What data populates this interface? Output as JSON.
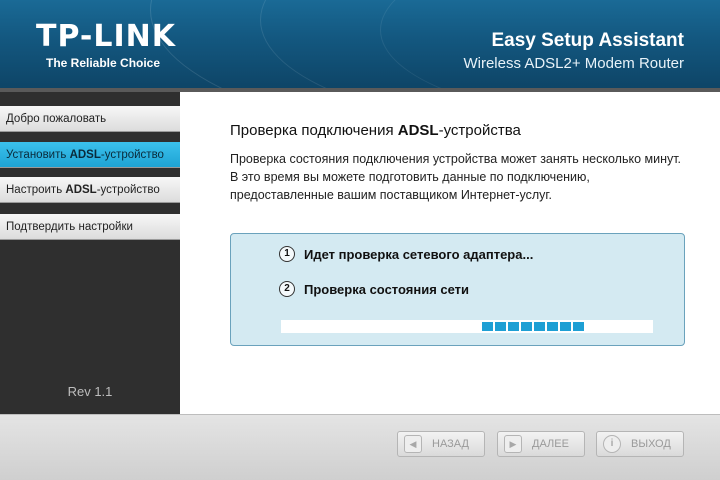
{
  "header": {
    "brand": "TP-LINK",
    "tagline": "The Reliable Choice",
    "title": "Easy Setup Assistant",
    "subtitle": "Wireless ADSL2+ Modem Router"
  },
  "sidebar": {
    "items": [
      {
        "pre": "Добро пожаловать",
        "bold": "",
        "post": ""
      },
      {
        "pre": "Установить ",
        "bold": "ADSL",
        "post": "-устройство"
      },
      {
        "pre": "Настроить ",
        "bold": "ADSL",
        "post": "-устройство"
      },
      {
        "pre": "Подтвердить настройки",
        "bold": "",
        "post": ""
      }
    ],
    "active_index": 1,
    "revision": "Rev 1.1"
  },
  "main": {
    "title_pre": "Проверка подключения ",
    "title_bold": "ADSL",
    "title_post": "-устройства",
    "description": "Проверка состояния подключения устройства может занять несколько минут. В это время вы можете подготовить данные по подключению, предоставленные вашим поставщиком Интернет-услуг.",
    "steps": [
      {
        "num": "1",
        "text": "Идет проверка сетевого адаптера..."
      },
      {
        "num": "2",
        "text": "Проверка состояния сети"
      }
    ],
    "progress": {
      "segment_count": 8,
      "start_fraction": 0.54,
      "accent": "#1e9fd4"
    }
  },
  "footer": {
    "back_label": "НАЗАД",
    "next_label": "ДАЛЕЕ",
    "exit_label": "ВЫХОД",
    "back_icon": "arrow-left-icon",
    "next_icon": "arrow-right-icon",
    "exit_icon": "exit-icon"
  },
  "colors": {
    "header": "#13577f",
    "active_tab": "#1ea3d4",
    "sidebar_bg": "#2f2f2f"
  }
}
